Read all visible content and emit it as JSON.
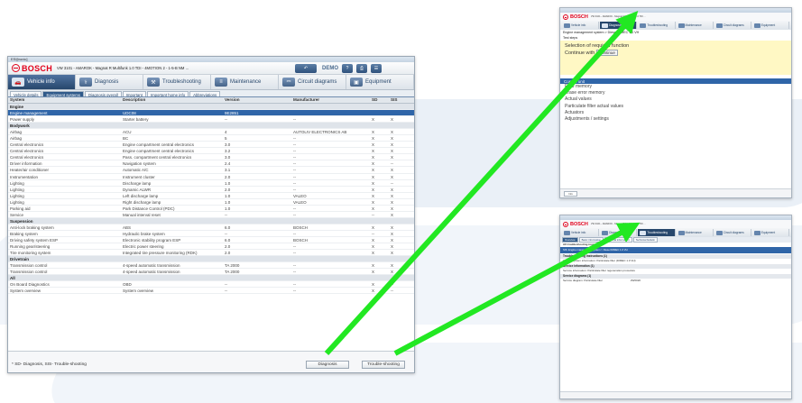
{
  "main_window": {
    "title": "ESI[tronic]",
    "brand": "BOSCH",
    "vehicle": "VW 3101 - AMAROK - Magnat R Multifunk 1.0 TDI - 4MOTION 2 - 1-5-B NM ...",
    "demo_label": "DEMO",
    "back_icon": "back-arrow-icon",
    "nav_tabs": [
      {
        "label": "Vehicle info",
        "icon": "car-icon"
      },
      {
        "label": "Diagnosis",
        "icon": "diagnosis-icon"
      },
      {
        "label": "Troubleshooting",
        "icon": "troubleshooting-icon"
      },
      {
        "label": "Maintenance",
        "icon": "maintenance-icon"
      },
      {
        "label": "Circuit diagrams",
        "icon": "circuit-diagram-icon"
      },
      {
        "label": "Equipment",
        "icon": "equipment-icon"
      }
    ],
    "sub_tabs": [
      "Vehicle details",
      "Equipment systems",
      "Diagnosis overall",
      "Important",
      "Important home info",
      "Abbreviations"
    ],
    "columns": [
      "System",
      "Description",
      "Version",
      "Manufacturer",
      "SD",
      "SIS"
    ],
    "rows": [
      {
        "type": "section",
        "cells": [
          "Engine",
          "",
          "",
          "",
          "",
          ""
        ]
      },
      {
        "type": "selected",
        "cells": [
          "Engine management",
          "UDC08",
          "9E2851",
          "",
          "",
          ""
        ]
      },
      {
        "type": "normal",
        "cells": [
          "Power supply",
          "Starter battery",
          "--",
          "--",
          "X",
          "X"
        ]
      },
      {
        "type": "section",
        "cells": [
          "Bodywork",
          "",
          "",
          "",
          "",
          ""
        ]
      },
      {
        "type": "normal",
        "cells": [
          "Airbag",
          "ACU",
          "4",
          "AUTOLIV ELECTRONICS AB",
          "X",
          "X"
        ]
      },
      {
        "type": "normal",
        "cells": [
          "Airbag",
          "BC",
          "5",
          "--",
          "X",
          "X"
        ]
      },
      {
        "type": "normal",
        "cells": [
          "Central electronics",
          "Engine compartment central electronics",
          "3.0",
          "--",
          "X",
          "X"
        ]
      },
      {
        "type": "normal",
        "cells": [
          "Central electronics",
          "Engine compartment central electronics",
          "3.2",
          "--",
          "X",
          "X"
        ]
      },
      {
        "type": "normal",
        "cells": [
          "Central electronics",
          "Pass. compartment central electronics",
          "3.0",
          "--",
          "X",
          "X"
        ]
      },
      {
        "type": "normal",
        "cells": [
          "Driver information",
          "Navigation system",
          "2.4",
          "--",
          "X",
          "--"
        ]
      },
      {
        "type": "normal",
        "cells": [
          "Heater/air conditioner",
          "Automatic A/C",
          "3.1",
          "--",
          "X",
          "X"
        ]
      },
      {
        "type": "normal",
        "cells": [
          "Instrumentation",
          "Instrument cluster",
          "2.0",
          "--",
          "X",
          "X"
        ]
      },
      {
        "type": "normal",
        "cells": [
          "Lighting",
          "Discharge lamp",
          "1.0",
          "--",
          "X",
          "--"
        ]
      },
      {
        "type": "normal",
        "cells": [
          "Lighting",
          "Dynamic ALWR",
          "2.0",
          "--",
          "X",
          "X"
        ]
      },
      {
        "type": "normal",
        "cells": [
          "Lighting",
          "Left discharge lamp",
          "1.0",
          "VALEO",
          "X",
          "X"
        ]
      },
      {
        "type": "normal",
        "cells": [
          "Lighting",
          "Right discharge lamp",
          "1.0",
          "VALEO",
          "X",
          "X"
        ]
      },
      {
        "type": "normal",
        "cells": [
          "Parking aid",
          "Park Distance Control (PDC)",
          "1.0",
          "--",
          "X",
          "X"
        ]
      },
      {
        "type": "normal",
        "cells": [
          "Service",
          "Manual interval reset",
          "--",
          "--",
          "--",
          "X"
        ]
      },
      {
        "type": "section",
        "cells": [
          "Suspension",
          "",
          "",
          "",
          "",
          ""
        ]
      },
      {
        "type": "normal",
        "cells": [
          "Anti-lock braking system",
          "ABS",
          "6.0",
          "BOSCH",
          "X",
          "X"
        ]
      },
      {
        "type": "normal",
        "cells": [
          "Braking system",
          "Hydraulic brake system",
          "--",
          "--",
          "--",
          "X"
        ]
      },
      {
        "type": "normal",
        "cells": [
          "Driving safety system ESP",
          "Electronic stability program ESP",
          "6.0",
          "BOSCH",
          "X",
          "X"
        ]
      },
      {
        "type": "normal",
        "cells": [
          "Running gear/steering",
          "Electric power steering",
          "2.0",
          "--",
          "X",
          "X"
        ]
      },
      {
        "type": "normal",
        "cells": [
          "Tire monitoring system",
          "Integrated tire pressure monitoring (RDK)",
          "2.0",
          "--",
          "X",
          "X"
        ]
      },
      {
        "type": "section",
        "cells": [
          "Drivetrain",
          "",
          "",
          "",
          "",
          ""
        ]
      },
      {
        "type": "normal",
        "cells": [
          "Transmission control",
          "4-speed automatic transmission",
          "TA 2000",
          "--",
          "X",
          "X"
        ]
      },
      {
        "type": "normal",
        "cells": [
          "Transmission control",
          "4-speed automatic transmission",
          "TA 2000",
          "--",
          "X",
          "X"
        ]
      },
      {
        "type": "section",
        "cells": [
          "All",
          "",
          "",
          "",
          "",
          ""
        ]
      },
      {
        "type": "normal",
        "cells": [
          "On Board Diagnostics",
          "OBD",
          "--",
          "--",
          "X",
          "--"
        ]
      },
      {
        "type": "normal",
        "cells": [
          "System overview",
          "System overview",
          "--",
          "--",
          "X",
          "--"
        ]
      }
    ],
    "legend": "* SD- Diagnosis, SIS- Trouble-shooting",
    "btn_diagnosis": "Diagnosis",
    "btn_troubleshooting": "Trouble-shooting"
  },
  "window_diagnosis": {
    "brand": "BOSCH",
    "vehicle": "VW 3101 - AMAROK - Magnat R Multifunk 1.0 TDI ...",
    "tabs": [
      "Vehicle info",
      "Diagnosis",
      "Troubleshooting",
      "Maintenance",
      "Circuit diagrams",
      "Equipment"
    ],
    "breadcrumb": "Engine management system > Diesel DIMEC 1.0 VH",
    "breadcrumb2": "Test steps",
    "prompt_line1": "Selection of required function",
    "prompt_line2": "Continue with",
    "continue_label": "Continue",
    "menu_header": "Control unit",
    "menu_items": [
      "ECU memory",
      "Erase error memory",
      "Actual values",
      "Particulate filter actual values",
      "Actuators",
      "Adjustments / settings"
    ],
    "footer_button": "Info"
  },
  "window_troubleshooting": {
    "brand": "BOSCH",
    "vehicle": "VW 3101 - AMAROK - Magnat R Multifunk 1.0 TDI ...",
    "tabs": [
      "Vehicle info",
      "Diagnosis",
      "Troubleshooting",
      "Maintenance",
      "Circuit diagrams",
      "Equipment"
    ],
    "sub_tabs": [
      "Overview",
      "Basic information",
      "General information",
      "Technical bulletin"
    ],
    "blue_bar": "All troubleshooting instructions",
    "selected_bar": "SIS: Engine management system > Diesel DIMEC 1.0 VH",
    "sections": [
      {
        "title": "Troubleshooting instructions (1)",
        "lines": [
          "Vehicle/system information: Particulate filter (DIMEC 1.0 VH)"
        ]
      },
      {
        "title": "Service information (1)",
        "lines": [
          "Service information: Particulate filter regeneration procedure"
        ]
      },
      {
        "title": "Service diagrams (1)",
        "lines": [
          "Service diagram: Particulate filter",
          "2W6020"
        ]
      }
    ]
  }
}
